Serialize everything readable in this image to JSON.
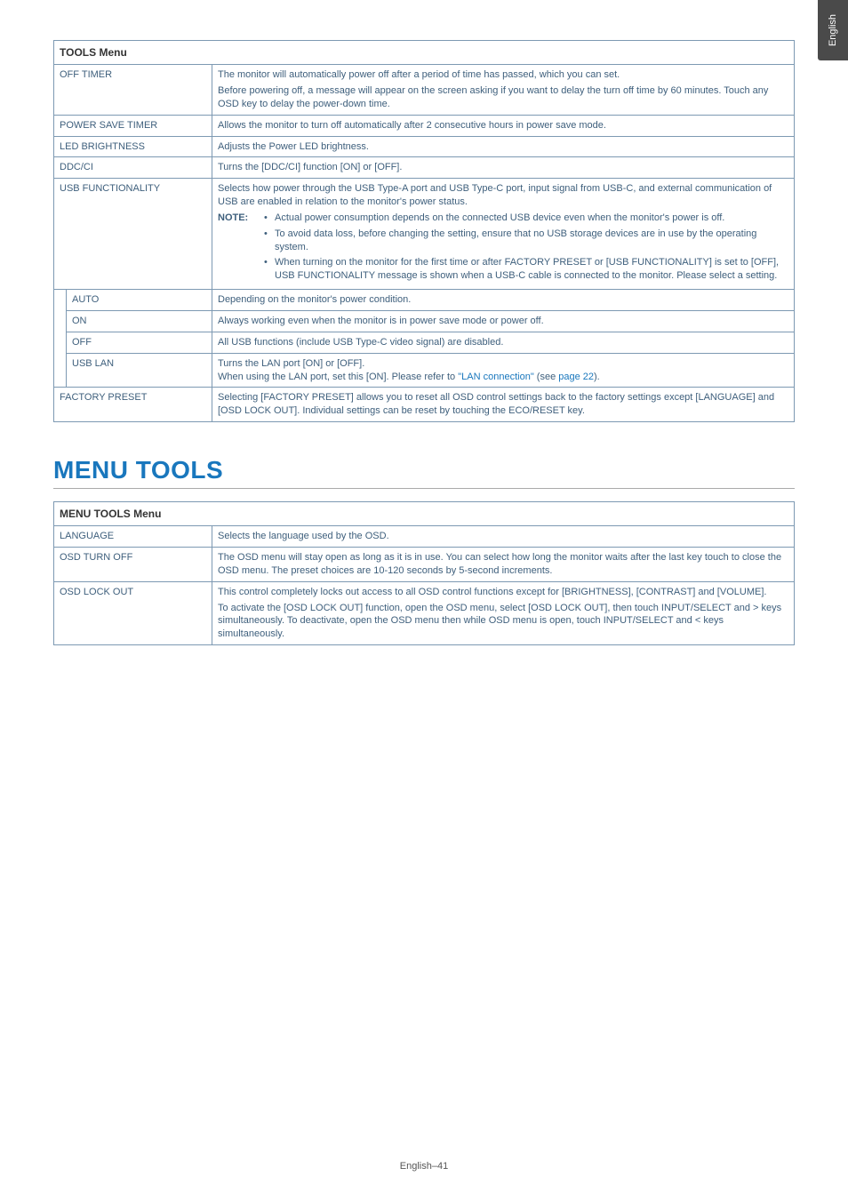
{
  "side_tab": "English",
  "tools_table": {
    "header": "TOOLS Menu",
    "rows": {
      "off_timer": {
        "label": "OFF TIMER",
        "p1": "The monitor will automatically power off after a period of time has passed, which you can set.",
        "p2": "Before powering off, a message will appear on the screen asking if you want to delay the turn off time by 60 minutes. Touch any OSD key to delay the power-down time."
      },
      "power_save_timer": {
        "label": "POWER SAVE TIMER",
        "desc": "Allows the monitor to turn off automatically after 2 consecutive hours in power save mode."
      },
      "led_brightness": {
        "label": "LED BRIGHTNESS",
        "desc": "Adjusts the Power LED brightness."
      },
      "ddcci": {
        "label": "DDC/CI",
        "desc": "Turns the [DDC/CI] function [ON] or [OFF]."
      },
      "usb_func": {
        "label": "USB FUNCTIONALITY",
        "p1": "Selects how power through the USB Type-A port and USB Type-C port, input signal from USB-C, and external communication of USB are enabled in relation to the monitor's power status.",
        "note_label": "NOTE: ",
        "b1": "Actual power consumption depends on the connected USB device even when the monitor's power is off.",
        "b2": "To avoid data loss, before changing the setting, ensure that no USB storage devices are in use by the operating system.",
        "b3": "When turning on the monitor for the first time or after FACTORY PRESET or [USB FUNCTIONALITY] is set to [OFF], USB FUNCTIONALITY message is shown when a USB-C cable is connected to the monitor. Please select a setting."
      },
      "auto": {
        "label": "AUTO",
        "desc": "Depending on the monitor's power condition."
      },
      "on": {
        "label": "ON",
        "desc": "Always working even when the monitor is in power save mode or power off."
      },
      "off": {
        "label": "OFF",
        "desc": "All USB functions (include USB Type-C video signal) are disabled."
      },
      "usb_lan": {
        "label": "USB LAN",
        "p1": "Turns the LAN port [ON] or [OFF].",
        "p2_a": "When using the LAN port, set this [ON]. Please refer to ",
        "p2_link1": "\"LAN connection\"",
        "p2_b": " (see ",
        "p2_link2": "page 22",
        "p2_c": ")."
      },
      "factory_preset": {
        "label": "FACTORY PRESET",
        "desc": "Selecting [FACTORY PRESET] allows you to reset all OSD control settings back to the factory settings except [LANGUAGE] and [OSD LOCK OUT]. Individual settings can be reset by touching the ECO/RESET key."
      }
    }
  },
  "menu_tools_heading": "MENU TOOLS",
  "menu_tools_table": {
    "header": "MENU TOOLS Menu",
    "rows": {
      "language": {
        "label": "LANGUAGE",
        "desc": "Selects the language used by the OSD."
      },
      "osd_turn_off": {
        "label": "OSD TURN OFF",
        "desc": "The OSD menu will stay open as long as it is in use. You can select how long the monitor waits after the last key touch to close the OSD menu. The preset choices are 10-120 seconds by 5-second increments."
      },
      "osd_lock_out": {
        "label": "OSD LOCK OUT",
        "p1": "This control completely locks out access to all OSD control functions except for [BRIGHTNESS], [CONTRAST] and [VOLUME].",
        "p2": "To activate the [OSD LOCK OUT] function, open the OSD menu, select [OSD LOCK OUT], then touch INPUT/SELECT and > keys simultaneously. To deactivate, open the OSD menu then while OSD menu is open, touch INPUT/SELECT and < keys simultaneously."
      }
    }
  },
  "footer": "English–41"
}
